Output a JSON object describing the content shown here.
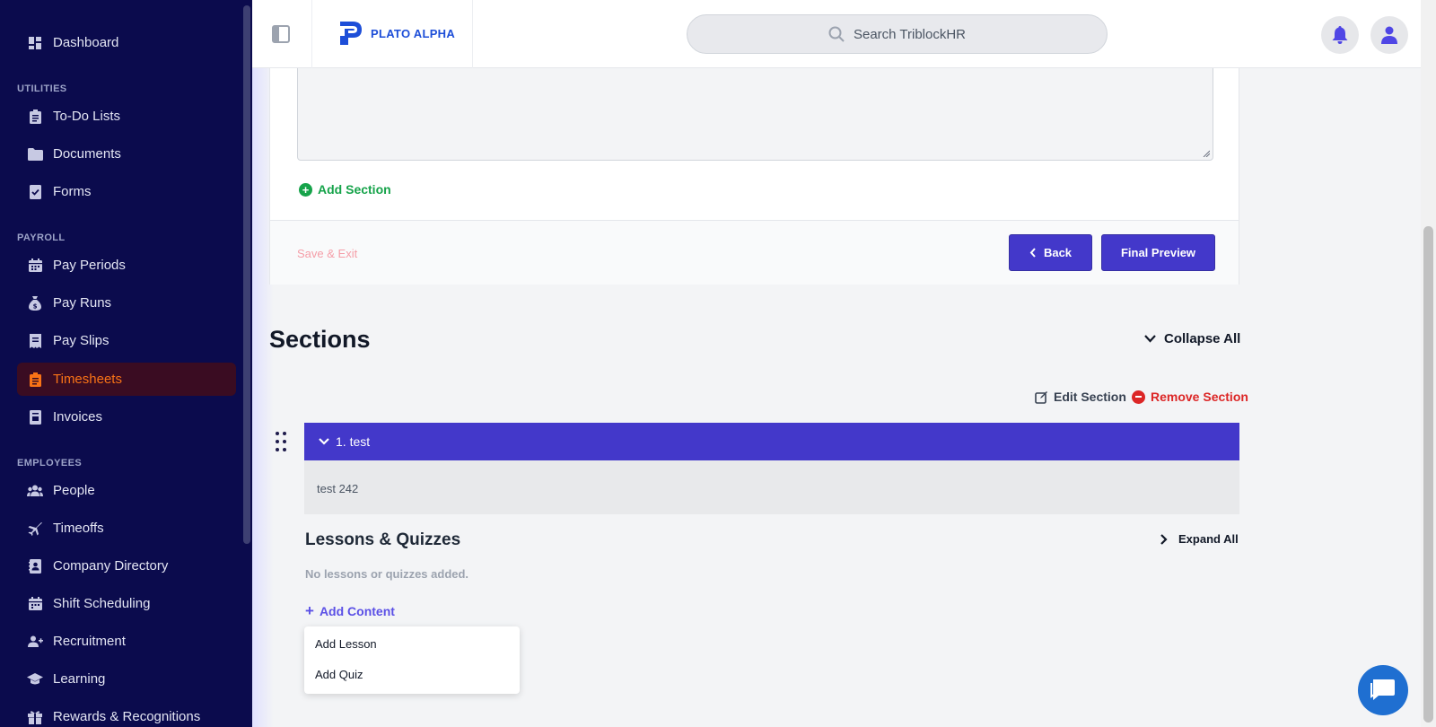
{
  "app": {
    "logo_text": "PLATO ALPHA",
    "search_placeholder": "Search TriblockHR"
  },
  "sidebar": {
    "dashboard": "Dashboard",
    "groups": {
      "utilities": "UTILITIES",
      "payroll": "PAYROLL",
      "employees": "EMPLOYEES"
    },
    "items": {
      "todo": "To-Do Lists",
      "documents": "Documents",
      "forms": "Forms",
      "pay_periods": "Pay Periods",
      "pay_runs": "Pay Runs",
      "pay_slips": "Pay Slips",
      "timesheets": "Timesheets",
      "invoices": "Invoices",
      "people": "People",
      "timeoffs": "Timeoffs",
      "company_directory": "Company Directory",
      "shift_scheduling": "Shift Scheduling",
      "recruitment": "Recruitment",
      "learning": "Learning",
      "rewards": "Rewards & Recognitions"
    },
    "active_item": "Timesheets"
  },
  "form": {
    "add_section": "Add Section",
    "save_exit": "Save & Exit",
    "back": "Back",
    "final_preview": "Final Preview"
  },
  "sections": {
    "title": "Sections",
    "collapse_all": "Collapse All",
    "edit_section": "Edit Section",
    "remove_section": "Remove Section",
    "section_title": "1. test",
    "section_description": "test 242",
    "lessons_title": "Lessons & Quizzes",
    "expand_all": "Expand All",
    "empty_text": "No lessons or quizzes added.",
    "add_content": "Add Content",
    "menu": [
      "Add Lesson",
      "Add Quiz"
    ]
  },
  "colors": {
    "sidebar_bg": "#0b0b4d",
    "accent": "#4338ca",
    "active": "#f97316",
    "success": "#16a34a",
    "danger": "#dc2626"
  }
}
